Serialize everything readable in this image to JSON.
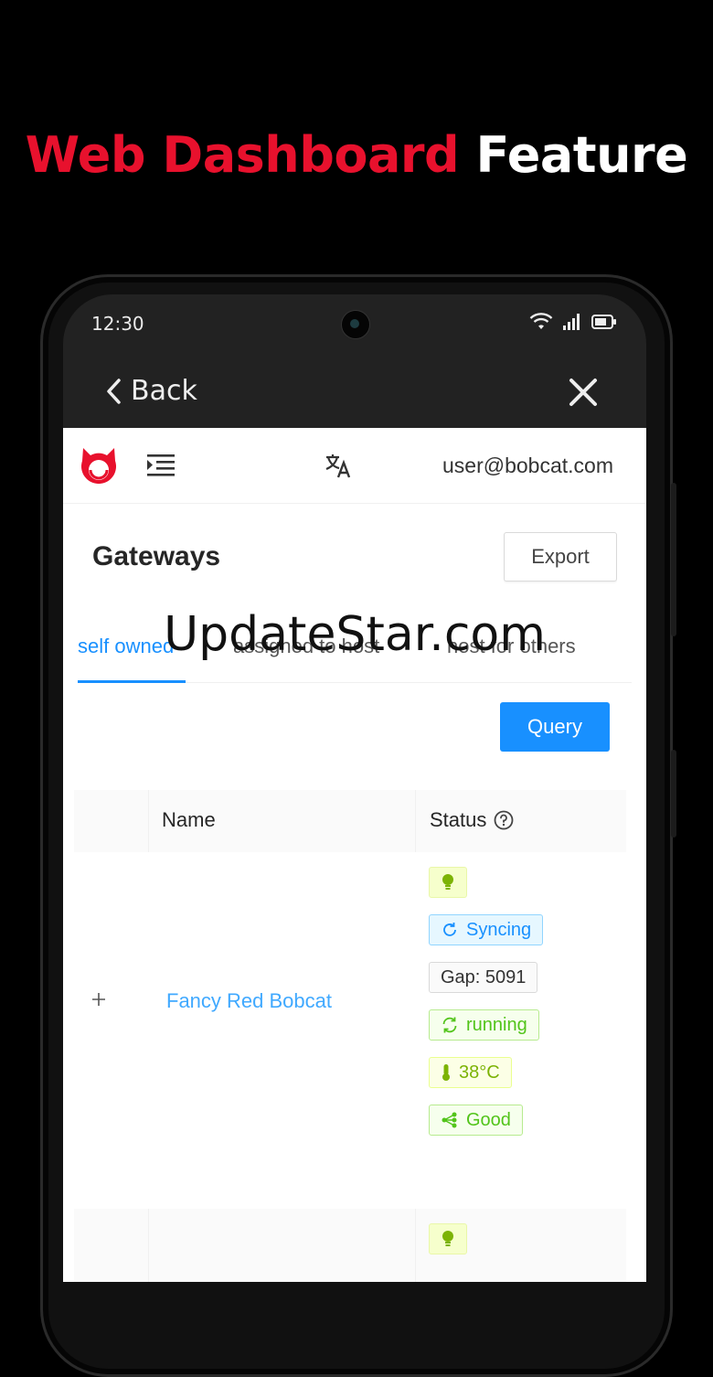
{
  "headline": {
    "part1": "Web Dashboard",
    "part2": "Feature"
  },
  "colors": {
    "brand_red": "#e8112d",
    "primary_blue": "#1890ff"
  },
  "status_bar": {
    "time": "12:30",
    "icons": [
      "wifi-icon",
      "signal-icon",
      "battery-icon"
    ]
  },
  "appbar": {
    "back_label": "Back",
    "close_icon": "close-icon"
  },
  "web_header": {
    "user_email": "user@bobcat.com",
    "icons": [
      "bobcat-logo",
      "menu-fold-icon",
      "translate-icon"
    ]
  },
  "page": {
    "title": "Gateways",
    "export_label": "Export",
    "query_label": "Query"
  },
  "tabs": [
    {
      "label": "self owned",
      "active": true
    },
    {
      "label": "assigned to host",
      "active": false
    },
    {
      "label": "host for others",
      "active": false
    }
  ],
  "watermark": "UpdateStar.com",
  "table": {
    "columns": {
      "name": "Name",
      "status": "Status"
    },
    "rows": [
      {
        "name": "Fancy Red Bobcat",
        "tags": {
          "sync": "Syncing",
          "gap": "Gap: 5091",
          "state": "running",
          "temp": "38°C",
          "network": "Good"
        }
      }
    ]
  }
}
